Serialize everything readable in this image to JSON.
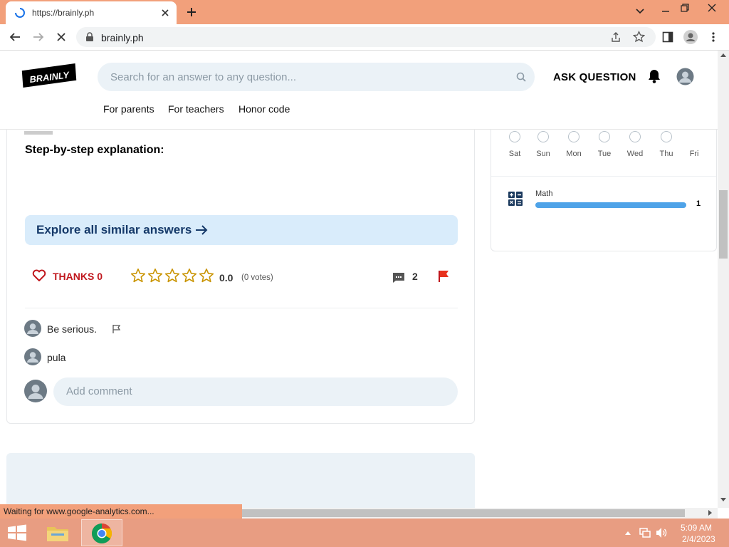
{
  "browser": {
    "tab_title": "https://brainly.ph",
    "url": "brainly.ph",
    "status_text": "Waiting for www.google-analytics.com..."
  },
  "header": {
    "logo_text": "BRAINLY",
    "search_placeholder": "Search for an answer to any question...",
    "ask_label": "ASK QUESTION",
    "nav": [
      "For parents",
      "For teachers",
      "Honor code"
    ]
  },
  "answer": {
    "step_title": "Step-by-step explanation:",
    "explore_label": "Explore all similar answers",
    "thanks_label": "THANKS 0",
    "rating_value": "0.0",
    "votes_label": "(0 votes)",
    "stars_filled": 0,
    "stars_total": 5,
    "comments_count": "2",
    "comments": [
      {
        "text": "Be serious."
      },
      {
        "text": "pula"
      }
    ],
    "add_comment_placeholder": "Add comment"
  },
  "sidebar": {
    "days": [
      {
        "label": "Sat",
        "active": false
      },
      {
        "label": "Sun",
        "active": false
      },
      {
        "label": "Mon",
        "active": false
      },
      {
        "label": "Tue",
        "active": false
      },
      {
        "label": "Wed",
        "active": false
      },
      {
        "label": "Thu",
        "active": false
      },
      {
        "label": "Fri",
        "active": true
      }
    ],
    "subject_name": "Math",
    "subject_count": "1",
    "subject_progress": 1.0
  },
  "taskbar": {
    "time": "5:09 AM",
    "date": "2/4/2023"
  },
  "colors": {
    "tabbar": "#f2a07b",
    "taskbar": "#e89d82",
    "accent_blue": "#4fa3e8",
    "thanks_red": "#c0171d",
    "star_gold": "#c99400"
  }
}
